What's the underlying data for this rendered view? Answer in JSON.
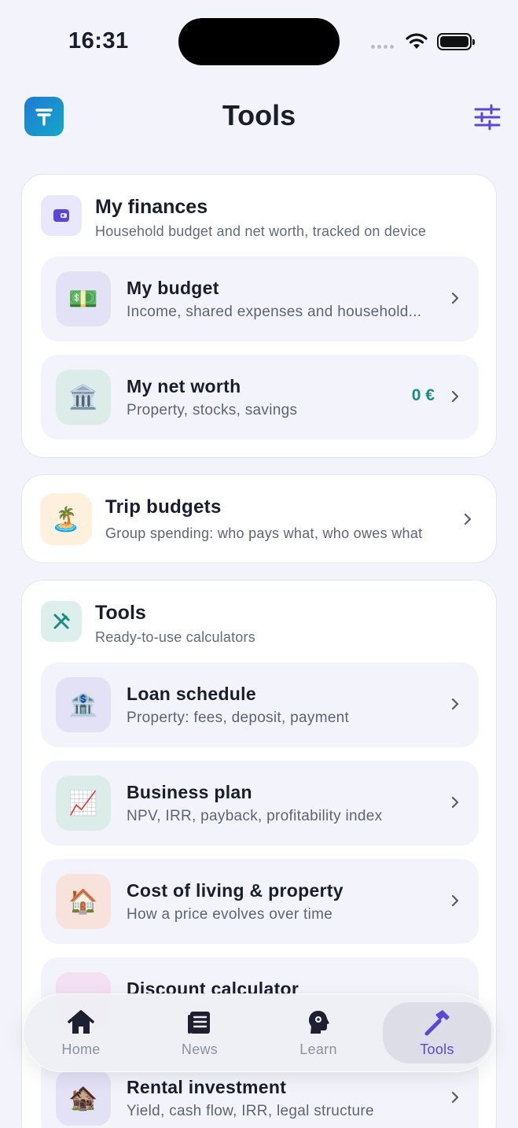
{
  "status_bar": {
    "time": "16:31"
  },
  "header": {
    "title": "Tools",
    "logo_icon": "app-logo-icon",
    "settings_icon": "sliders-icon"
  },
  "colors": {
    "accent": "#5a47d8",
    "positive": "#1a8c84",
    "background": "#f3f4fb"
  },
  "finances": {
    "title": "My finances",
    "subtitle": "Household budget and net worth, tracked on device",
    "icon": "wallet-icon",
    "items": [
      {
        "title": "My budget",
        "subtitle": "Income, shared expenses and household...",
        "icon": "money-icon",
        "value": ""
      },
      {
        "title": "My net worth",
        "subtitle": "Property, stocks, savings",
        "icon": "bank-icon",
        "value": "0 €"
      }
    ]
  },
  "trip": {
    "title": "Trip budgets",
    "subtitle": "Group spending: who pays what, who owes what",
    "icon": "island-icon"
  },
  "tools": {
    "title": "Tools",
    "subtitle": "Ready-to-use calculators",
    "icon": "tools-icon",
    "items": [
      {
        "title": "Loan schedule",
        "subtitle": "Property: fees, deposit, payment",
        "icon": "bank-loan-icon"
      },
      {
        "title": "Business plan",
        "subtitle": "NPV, IRR, payback, profitability index",
        "icon": "chart-up-icon"
      },
      {
        "title": "Cost of living & property",
        "subtitle": "How a price evolves over time",
        "icon": "house-icon"
      },
      {
        "title": "Discount calculator",
        "subtitle": "",
        "icon": "discount-icon"
      },
      {
        "title": "Rental investment",
        "subtitle": "Yield, cash flow, IRR, legal structure",
        "icon": "rental-house-icon"
      }
    ]
  },
  "tab_bar": {
    "tabs": [
      {
        "label": "Home",
        "icon": "home-icon",
        "active": false
      },
      {
        "label": "News",
        "icon": "news-icon",
        "active": false
      },
      {
        "label": "Learn",
        "icon": "brain-icon",
        "active": false
      },
      {
        "label": "Tools",
        "icon": "hammer-icon",
        "active": true
      }
    ]
  }
}
